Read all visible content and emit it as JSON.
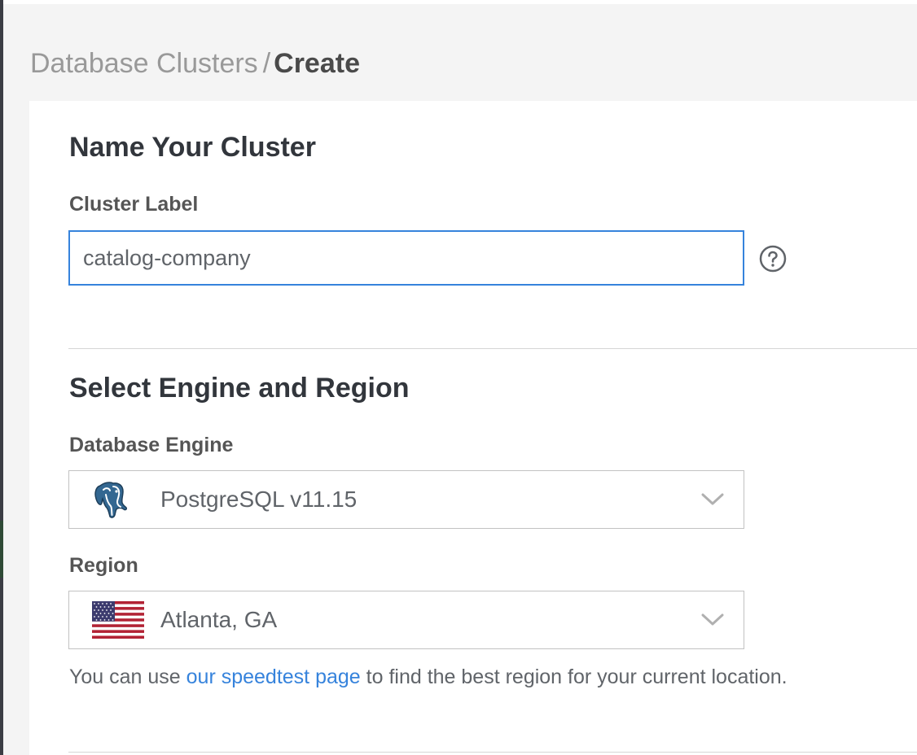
{
  "breadcrumb": {
    "parent": "Database Clusters",
    "separator": "/",
    "current": "Create"
  },
  "name_section": {
    "title": "Name Your Cluster",
    "cluster_label": {
      "label": "Cluster Label",
      "value": "catalog-company",
      "help_icon": "help-circle-icon"
    }
  },
  "engine_section": {
    "title": "Select Engine and Region",
    "engine": {
      "label": "Database Engine",
      "selected": "PostgreSQL v11.15",
      "icon": "postgresql-elephant-icon"
    },
    "region": {
      "label": "Region",
      "selected": "Atlanta, GA",
      "icon": "us-flag-icon"
    },
    "hint": {
      "prefix": "You can use ",
      "link_text": "our speedtest page",
      "suffix": " to find the best region for your current location."
    }
  },
  "colors": {
    "accent": "#3683dc",
    "heading": "#32363c",
    "muted": "#999999",
    "background": "#f4f4f4"
  }
}
